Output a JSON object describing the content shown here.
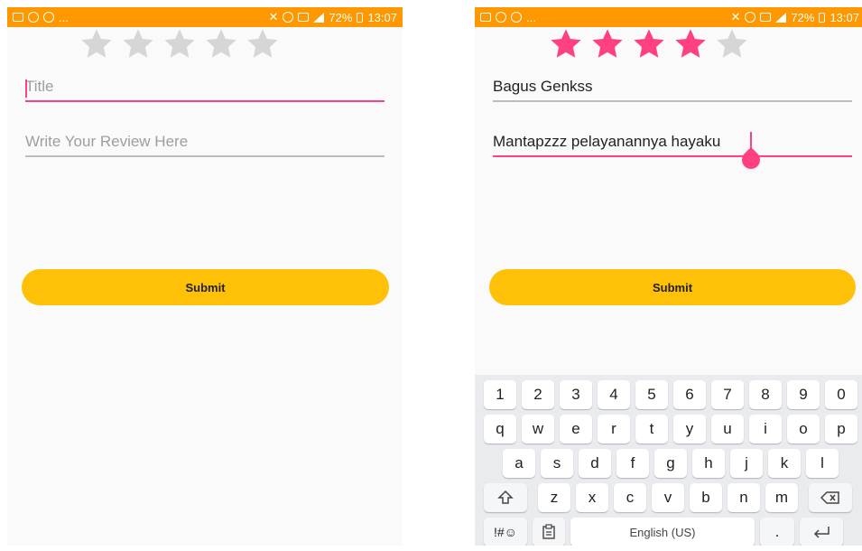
{
  "status": {
    "battery": "72%",
    "time": "13:07",
    "ellipsis": "..."
  },
  "left": {
    "rating": 0,
    "rating_max": 5,
    "title_placeholder": "Title",
    "review_placeholder": "Write Your Review Here",
    "submit_label": "Submit"
  },
  "right": {
    "rating": 4,
    "rating_max": 5,
    "title_value": "Bagus Genkss",
    "review_value": "Mantapzzz pelayanannya hayaku",
    "submit_label": "Submit",
    "keyboard": {
      "number_row": [
        "1",
        "2",
        "3",
        "4",
        "5",
        "6",
        "7",
        "8",
        "9",
        "0"
      ],
      "row1": [
        "q",
        "w",
        "e",
        "r",
        "t",
        "y",
        "u",
        "i",
        "o",
        "p"
      ],
      "row2": [
        "a",
        "s",
        "d",
        "f",
        "g",
        "h",
        "j",
        "k",
        "l"
      ],
      "row3": [
        "z",
        "x",
        "c",
        "v",
        "b",
        "n",
        "m"
      ],
      "symbols_label": "!#☺",
      "space_label": "English (US)",
      "period_label": "."
    }
  },
  "colors": {
    "status_bar": "#ff9800",
    "star_active": "#ff4081",
    "star_inactive": "#d6d6d6",
    "submit_bg": "#ffc107",
    "focus_underline": "#ff4081"
  },
  "icons": [
    "gallery-icon",
    "whatsapp-icon",
    "at-icon",
    "mute-icon",
    "alarm-icon",
    "notification-icon",
    "signal-icon",
    "battery-icon",
    "star-icon",
    "shift-icon",
    "backspace-icon",
    "clipboard-icon",
    "enter-icon"
  ]
}
